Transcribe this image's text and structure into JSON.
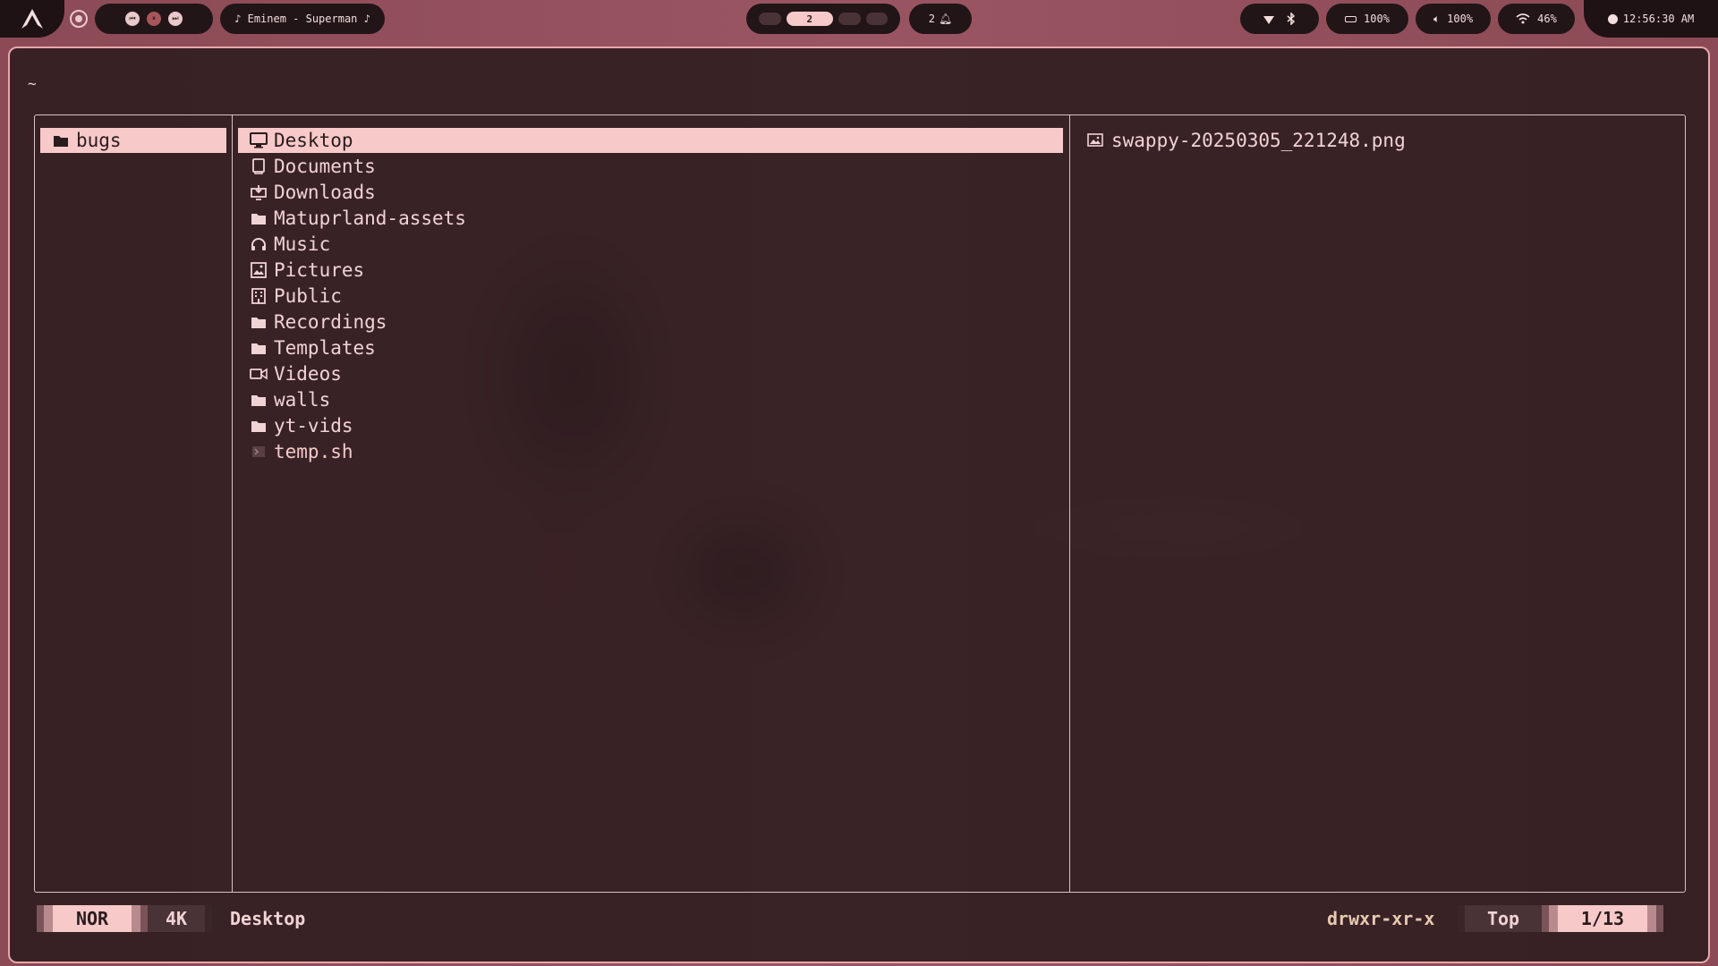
{
  "topbar": {
    "media_title": "♪ Eminem - Superman ♪",
    "workspace_active": "2",
    "notifications": "2",
    "battery": "100%",
    "volume": "100%",
    "wifi": "46%",
    "clock": "12:56:30 AM"
  },
  "terminal": {
    "cwd": "~",
    "parent_items": [
      {
        "name": "bugs",
        "icon": "folder-icon",
        "selected": true
      }
    ],
    "current_items": [
      {
        "name": "Desktop",
        "icon": "monitor-icon",
        "selected": true
      },
      {
        "name": "Documents",
        "icon": "document-icon"
      },
      {
        "name": "Downloads",
        "icon": "download-icon"
      },
      {
        "name": "Matuprland-assets",
        "icon": "folder-icon"
      },
      {
        "name": "Music",
        "icon": "headphones-icon"
      },
      {
        "name": "Pictures",
        "icon": "picture-icon"
      },
      {
        "name": "Public",
        "icon": "building-icon"
      },
      {
        "name": "Recordings",
        "icon": "folder-icon"
      },
      {
        "name": "Templates",
        "icon": "folder-icon"
      },
      {
        "name": "Videos",
        "icon": "video-icon"
      },
      {
        "name": "walls",
        "icon": "folder-icon"
      },
      {
        "name": "yt-vids",
        "icon": "folder-icon"
      },
      {
        "name": "temp.sh",
        "icon": "terminal-file-icon"
      }
    ],
    "preview_items": [
      {
        "name": "swappy-20250305_221248.png",
        "icon": "image-file-icon"
      }
    ]
  },
  "statusbar": {
    "mode": "NOR",
    "size": "4K",
    "hovered": "Desktop",
    "permissions": "drwxr-xr-x",
    "position": "Top",
    "count": "1/13"
  },
  "colors": {
    "accent": "#f7c9c9",
    "background": "#2a1b1d",
    "border": "#e7a8aa"
  }
}
